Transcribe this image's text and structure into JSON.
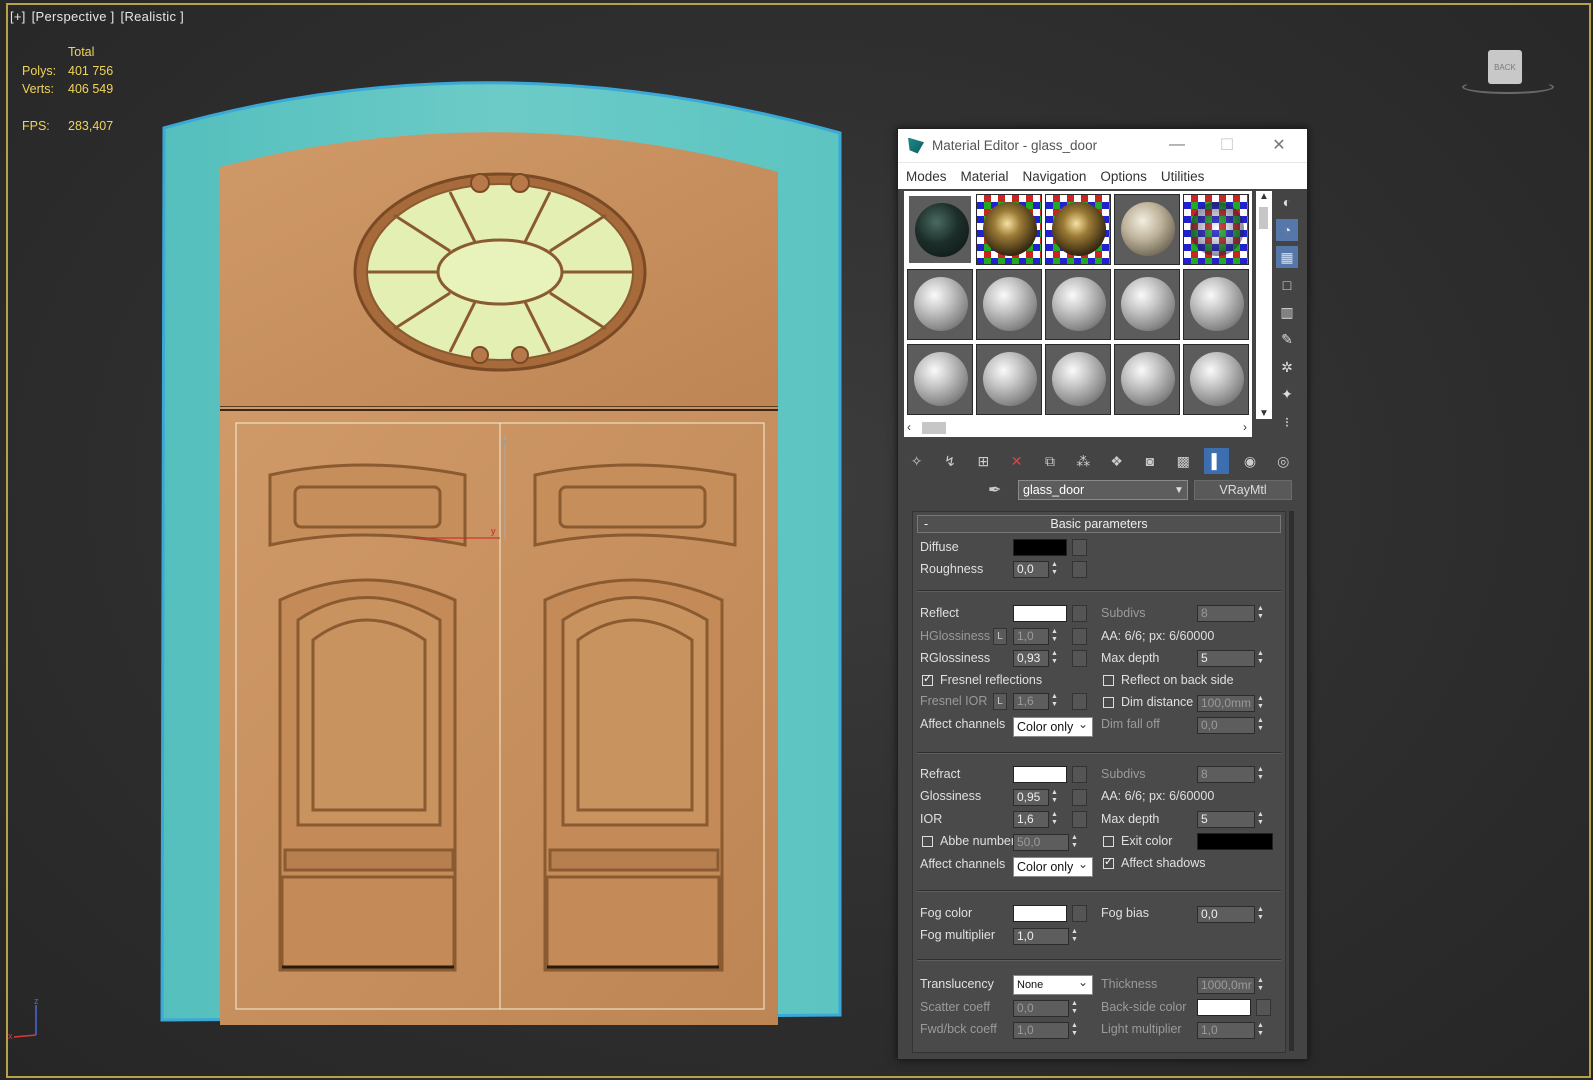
{
  "viewport": {
    "label_parts": [
      "[+]",
      "[Perspective ]",
      "[Realistic ]"
    ],
    "stats": {
      "header": "Total",
      "polys_label": "Polys:",
      "polys_value": "401 756",
      "verts_label": "Verts:",
      "verts_value": "406 549",
      "fps_label": "FPS:",
      "fps_value": "283,407"
    },
    "viewcube_label": "BACK",
    "axis_labels": {
      "x": "x",
      "y": "y",
      "z": "z"
    }
  },
  "colors": {
    "frame_teal": "#5fc7c4",
    "door_wood": "#c98f5c",
    "glass": "#e8f0b8",
    "highlight": "#3d6fb0"
  },
  "material_editor": {
    "title": "Material Editor - glass_door",
    "window_buttons": [
      "—",
      "☐",
      "✕"
    ],
    "menu": [
      "Modes",
      "Material",
      "Navigation",
      "Options",
      "Utilities"
    ],
    "material_name": "glass_door",
    "material_type": "VRayMtl",
    "rollout_title": "Basic parameters",
    "rollout_toggle": "-",
    "diffuse": {
      "label": "Diffuse",
      "color": "#000000"
    },
    "roughness": {
      "label": "Roughness",
      "value": "0,0"
    },
    "reflect": {
      "label": "Reflect",
      "color": "#ffffff",
      "hglossiness_label": "HGlossiness",
      "hglossiness_lock": "L",
      "hglossiness": "1,0",
      "rglossiness_label": "RGlossiness",
      "rglossiness": "0,93",
      "fresnel_label": "Fresnel reflections",
      "fresnel_checked": true,
      "fresnel_ior_label": "Fresnel IOR",
      "fresnel_ior_lock": "L",
      "fresnel_ior": "1,6",
      "affect_label": "Affect channels",
      "affect_value": "Color only",
      "subdivs_label": "Subdivs",
      "subdivs": "8",
      "aa_text": "AA: 6/6; px: 6/60000",
      "maxdepth_label": "Max depth",
      "maxdepth": "5",
      "backside_label": "Reflect on back side",
      "dimdist_label": "Dim distance",
      "dimdist": "100,0mm",
      "dimfall_label": "Dim fall off",
      "dimfall": "0,0"
    },
    "refract": {
      "label": "Refract",
      "color": "#ffffff",
      "glossiness_label": "Glossiness",
      "glossiness": "0,95",
      "ior_label": "IOR",
      "ior": "1,6",
      "abbe_label": "Abbe number",
      "abbe": "50,0",
      "affect_label": "Affect channels",
      "affect_value": "Color only",
      "subdivs_label": "Subdivs",
      "subdivs": "8",
      "aa_text": "AA: 6/6; px: 6/60000",
      "maxdepth_label": "Max depth",
      "maxdepth": "5",
      "exit_label": "Exit color",
      "exit_color": "#000000",
      "shadows_label": "Affect shadows",
      "shadows_checked": true
    },
    "fog": {
      "color_label": "Fog color",
      "color": "#ffffff",
      "mult_label": "Fog multiplier",
      "mult": "1,0",
      "bias_label": "Fog bias",
      "bias": "0,0"
    },
    "translucency": {
      "label": "Translucency",
      "value": "None",
      "thickness_label": "Thickness",
      "thickness": "1000,0mr",
      "scatter_label": "Scatter coeff",
      "scatter": "0,0",
      "backside_label": "Back-side color",
      "backside_color": "#ffffff",
      "fwd_label": "Fwd/bck coeff",
      "fwd": "1,0",
      "light_label": "Light multiplier",
      "light": "1,0"
    }
  }
}
